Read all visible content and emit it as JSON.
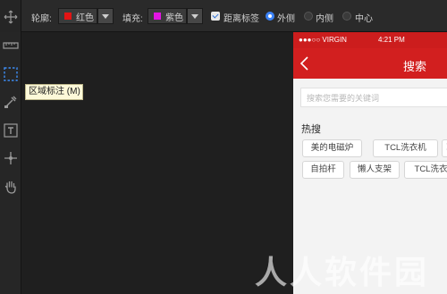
{
  "toolbar": {
    "outline_label": "轮廓:",
    "outline_color_name": "红色",
    "outline_color": "#e31414",
    "fill_label": "填充:",
    "fill_color_name": "紫色",
    "fill_color": "#e315e3",
    "distance_label_text": "距离标签",
    "distance_label_checked": true,
    "placement": {
      "selected": "outside",
      "options": [
        {
          "value": "outside",
          "label": "外侧"
        },
        {
          "value": "inside",
          "label": "内侧"
        },
        {
          "value": "center",
          "label": "中心"
        }
      ]
    }
  },
  "tools": [
    "move-icon",
    "ruler-icon",
    "area-marquee-icon",
    "color-picker-icon",
    "text-icon",
    "crosshair-icon",
    "hand-icon"
  ],
  "tooltip": {
    "text": "区域标注 (M)"
  },
  "phone": {
    "carrier": "●●●○○ VIRGIN",
    "time": "4:21 PM",
    "nav_title": "搜索",
    "search_placeholder": "搜索您需要的关键词",
    "hot_title": "热搜",
    "hot_tags_row1": [
      "美的电磁炉",
      "TCL洗衣机",
      "冰"
    ],
    "hot_tags_row2": [
      "自拍杆",
      "懒人支架",
      "TCL洗衣"
    ]
  },
  "watermark": "人人软件园"
}
